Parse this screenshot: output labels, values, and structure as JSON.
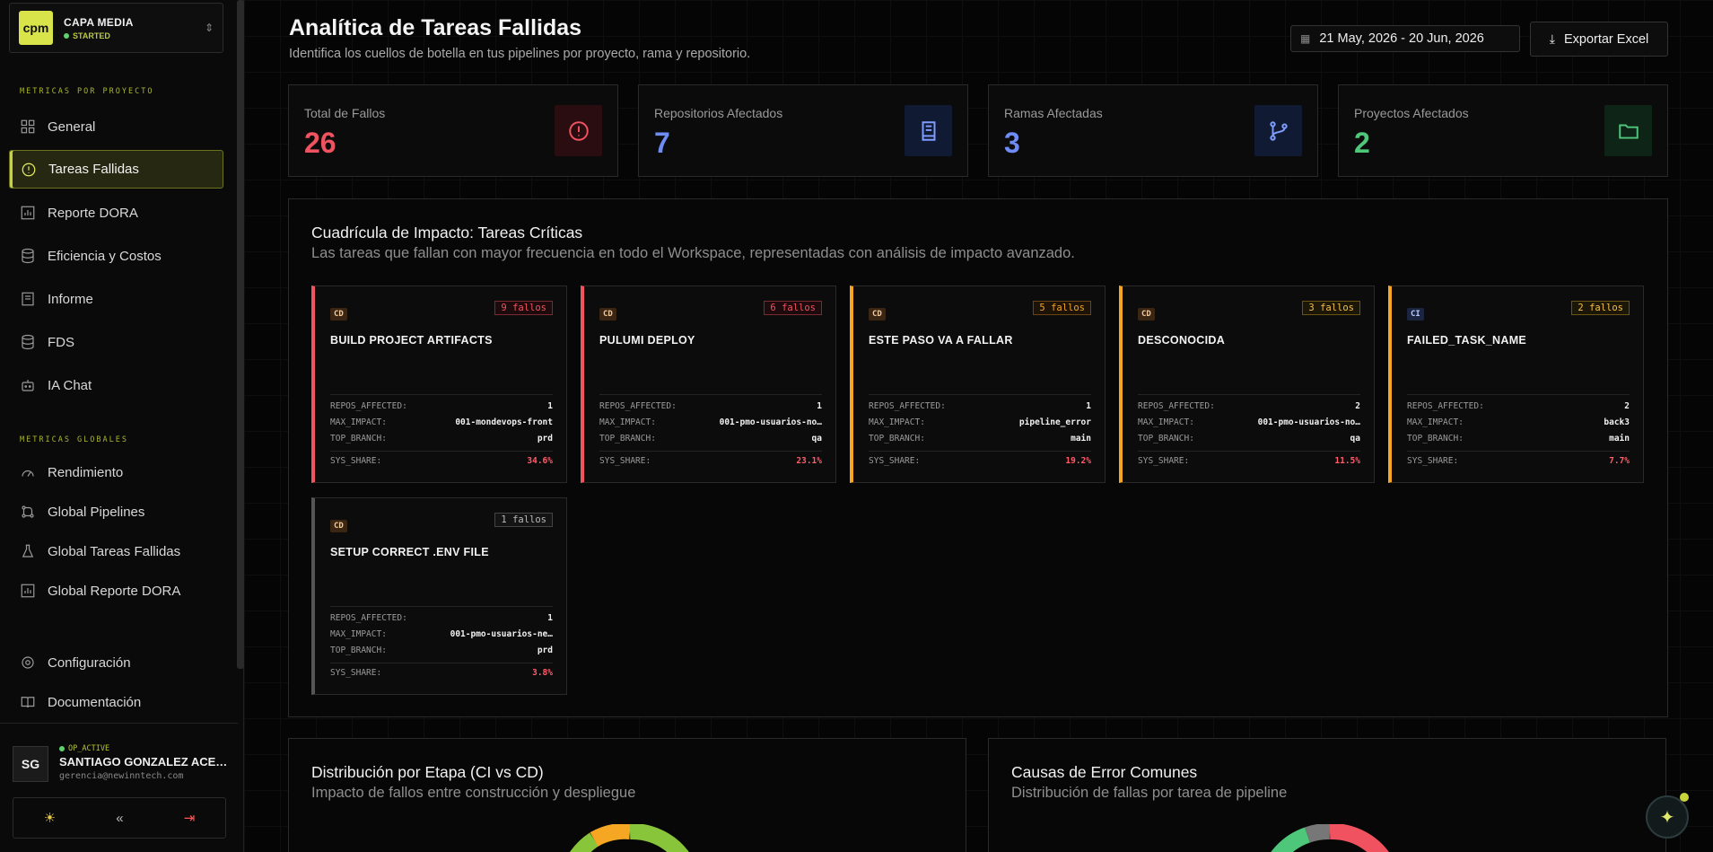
{
  "org": {
    "logo": "cpm",
    "name": "CAPA MEDIA",
    "status": "STARTED"
  },
  "sidebar": {
    "project_section": "METRICAS POR PROYECTO",
    "project_items": [
      {
        "label": "General",
        "icon": "grid-icon"
      },
      {
        "label": "Tareas Fallidas",
        "icon": "alert-circle-icon",
        "active": true
      },
      {
        "label": "Reporte DORA",
        "icon": "bar-chart-icon"
      },
      {
        "label": "Eficiencia y Costos",
        "icon": "database-icon"
      },
      {
        "label": "Informe",
        "icon": "document-icon"
      },
      {
        "label": "FDS",
        "icon": "database-icon"
      },
      {
        "label": "IA Chat",
        "icon": "bot-icon"
      }
    ],
    "global_section": "METRICAS GLOBALES",
    "global_items": [
      {
        "label": "Rendimiento",
        "icon": "gauge-icon"
      },
      {
        "label": "Global Pipelines",
        "icon": "pipeline-icon"
      },
      {
        "label": "Global Tareas Fallidas",
        "icon": "flask-icon"
      },
      {
        "label": "Global Reporte DORA",
        "icon": "bar-chart-icon"
      }
    ],
    "bottom_items": [
      {
        "label": "Configuración",
        "icon": "gear-icon"
      },
      {
        "label": "Documentación",
        "icon": "book-icon"
      }
    ]
  },
  "user": {
    "initials": "SG",
    "status": "OP_ACTIVE",
    "name": "SANTIAGO GONZALEZ ACEVEDO",
    "email": "gerencia@newinntech.com"
  },
  "header": {
    "title": "Analítica de Tareas Fallidas",
    "subtitle": "Identifica los cuellos de botella en tus pipelines por proyecto, rama y repositorio.",
    "date_range": "21 May, 2026 - 20 Jun, 2026",
    "export_label": "Exportar Excel"
  },
  "stats": [
    {
      "label": "Total de Fallos",
      "value": "26",
      "color": "#f0535f"
    },
    {
      "label": "Repositorios Afectados",
      "value": "7",
      "color": "#6f8cf5"
    },
    {
      "label": "Ramas Afectadas",
      "value": "3",
      "color": "#6f8cf5"
    },
    {
      "label": "Proyectos Afectados",
      "value": "2",
      "color": "#4fc77a"
    }
  ],
  "impact": {
    "title": "Cuadrícula de Impacto: Tareas Críticas",
    "subtitle": "Las tareas que fallan con mayor frecuencia en todo el Workspace, representadas con análisis de impacto avanzado.",
    "keys": {
      "repos": "REPOS_AFFECTED:",
      "impact": "MAX_IMPACT:",
      "branch": "TOP_BRANCH:",
      "share": "SYS_SHARE:"
    },
    "tasks": [
      {
        "type": "CD",
        "fails": "9 fallos",
        "name": "BUILD PROJECT ARTIFACTS",
        "repos": "1",
        "impact": "001-mondevops-front",
        "branch": "prd",
        "share": "34.6%"
      },
      {
        "type": "CD",
        "fails": "6 fallos",
        "name": "PULUMI DEPLOY",
        "repos": "1",
        "impact": "001-pmo-usuarios-no…",
        "branch": "qa",
        "share": "23.1%"
      },
      {
        "type": "CD",
        "fails": "5 fallos",
        "name": "ESTE PASO VA A FALLAR",
        "repos": "1",
        "impact": "pipeline_error",
        "branch": "main",
        "share": "19.2%"
      },
      {
        "type": "CD",
        "fails": "3 fallos",
        "name": "DESCONOCIDA",
        "repos": "2",
        "impact": "001-pmo-usuarios-no…",
        "branch": "qa",
        "share": "11.5%"
      },
      {
        "type": "CI",
        "fails": "2 fallos",
        "name": "FAILED_TASK_NAME",
        "repos": "2",
        "impact": "back3",
        "branch": "main",
        "share": "7.7%"
      },
      {
        "type": "CD",
        "fails": "1 fallos",
        "name": "SETUP CORRECT .ENV FILE",
        "repos": "1",
        "impact": "001-pmo-usuarios-ne…",
        "branch": "prd",
        "share": "3.8%"
      }
    ]
  },
  "stage_panel": {
    "title": "Distribución por Etapa (CI vs CD)",
    "subtitle": "Impacto de fallos entre construcción y despliegue"
  },
  "causes_panel": {
    "title": "Causas de Error Comunes",
    "subtitle": "Distribución de fallas por tarea de pipeline"
  },
  "colors": {
    "accent": "#c7d33a",
    "red": "#f0535f",
    "orange": "#f5a623",
    "blue": "#6f8cf5",
    "green": "#4fc77a"
  }
}
